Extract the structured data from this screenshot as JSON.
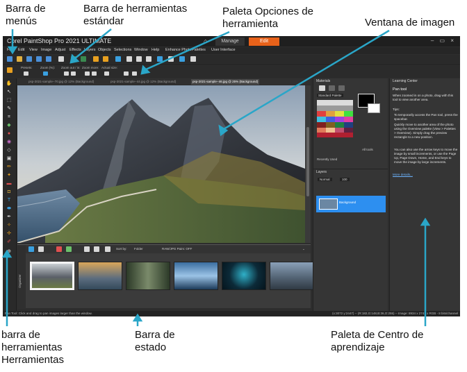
{
  "callouts": {
    "menubar": [
      "Barra de",
      "menús"
    ],
    "standard_toolbar": [
      "Barra de herramientas",
      "estándar"
    ],
    "tool_options": [
      "Paleta Opciones de",
      "herramienta"
    ],
    "image_window": [
      "Ventana de imagen"
    ],
    "tools_toolbar": [
      "barra de",
      "herramientas",
      "Herramientas"
    ],
    "status_bar": [
      "Barra de",
      "estado"
    ],
    "learning_center": [
      "Paleta de Centro de",
      "aprendizaje"
    ]
  },
  "app": {
    "title": "Corel PaintShop Pro 2021 ULTIMATE",
    "tabs": {
      "manage": "Manage",
      "edit": "Edit"
    },
    "window_buttons": "– ▭ ×"
  },
  "menu": [
    "File",
    "Edit",
    "View",
    "Image",
    "Adjust",
    "Effects",
    "Layers",
    "Objects",
    "Selections",
    "Window",
    "Help",
    "Enhance Photo",
    "Palettes",
    "User Interface"
  ],
  "options_bar": {
    "presets": "Presets:",
    "zoom_pct": "Zoom (%):",
    "zoom_inout": "Zoom out / in:",
    "zoom_more": "Zoom more:",
    "actual_size": "Actual size:"
  },
  "doc_tabs": [
    "psp-2021-sample--70.jpg @ 12% (Background)",
    "psp-2021-sample--44.jpg @ 12% (Background)",
    "psp-2021-sample--46.jpg @ 25% (Background)"
  ],
  "organizer": {
    "label": "Organizer",
    "sort_by": "Sort by:",
    "sort_value": "Folder",
    "raw_pairs": "RAW/JPG Pairs: OFF"
  },
  "materials": {
    "title": "Materials",
    "palette": "Standard Palette",
    "recently_used": "Recently Used",
    "all_tools": "All tools"
  },
  "layers": {
    "title": "Layers",
    "blend": "Normal",
    "opacity": "100",
    "layer_name": "Background"
  },
  "learning_center": {
    "title": "Learning Center",
    "heading": "Pan tool",
    "intro": "When zoomed in on a photo, drag with this tool to view another area.",
    "tips_label": "Tips:",
    "tips": [
      "To temporarily access the Pan tool, press the spacebar.",
      "Quickly move to another area of the photo using the Overview palette (View > Palettes > Overview). Simply drag the preview rectangle to a new position.",
      "You can also use the arrow keys to move the image by small increments, or use the Page Up, Page Down, Home, and End keys to move the image by large increments."
    ],
    "more_link": "More details..."
  },
  "status": {
    "left": "Pan Tool: Click and drag to pan images larger than the window.",
    "right": "(x:3072 y:2447) -- (R:182,G:148,B:36,O:255) -- Image: 8934 x 2741 x RGB - 8 bits/channel"
  }
}
